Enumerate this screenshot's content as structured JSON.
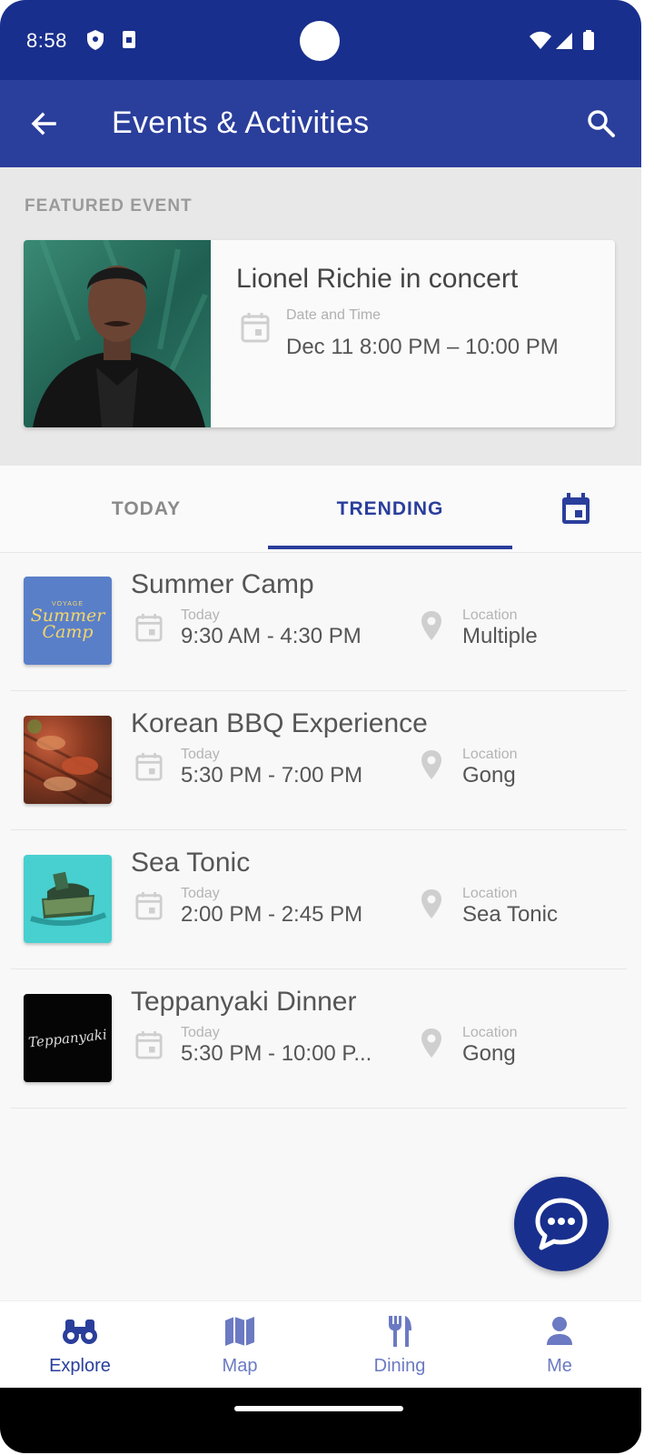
{
  "status_bar": {
    "time": "8:58"
  },
  "app_bar": {
    "title": "Events & Activities"
  },
  "featured": {
    "section_label": "FEATURED EVENT",
    "title": "Lionel Richie in concert",
    "datetime_label": "Date and Time",
    "datetime_value": "Dec 11 8:00 PM – 10:00 PM"
  },
  "tabs": {
    "today": "TODAY",
    "trending": "TRENDING",
    "selected": "trending"
  },
  "events": [
    {
      "title": "Summer Camp",
      "day_label": "Today",
      "time": "9:30 AM - 4:30 PM",
      "location_label": "Location",
      "location": "Multiple",
      "thumb_small_text": "VOYAGE",
      "thumb_text": "Summer Camp"
    },
    {
      "title": "Korean BBQ Experience",
      "day_label": "Today",
      "time": "5:30 PM - 7:00 PM",
      "location_label": "Location",
      "location": "Gong"
    },
    {
      "title": "Sea Tonic",
      "day_label": "Today",
      "time": "2:00 PM - 2:45 PM",
      "location_label": "Location",
      "location": "Sea Tonic"
    },
    {
      "title": "Teppanyaki Dinner",
      "day_label": "Today",
      "time": "5:30 PM - 10:00 P...",
      "location_label": "Location",
      "location": "Gong",
      "thumb_text": "Teppanyaki"
    }
  ],
  "bottom_nav": {
    "items": [
      {
        "label": "Explore",
        "icon": "binoculars-icon",
        "active": true
      },
      {
        "label": "Map",
        "icon": "map-icon",
        "active": false
      },
      {
        "label": "Dining",
        "icon": "fork-knife-icon",
        "active": false
      },
      {
        "label": "Me",
        "icon": "person-icon",
        "active": false
      }
    ]
  },
  "colors": {
    "status_bar": "#192f8d",
    "app_bar": "#2a3e9b",
    "accent": "#2a3e9b",
    "nav_inactive": "#6b7ac2"
  }
}
